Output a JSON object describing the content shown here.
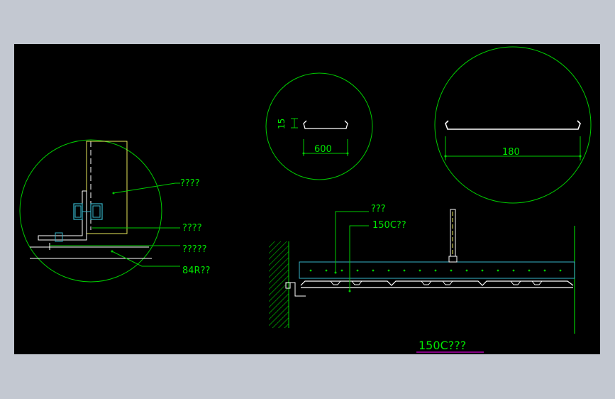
{
  "colors": {
    "background": "#c3c8d1",
    "canvas": "#000000",
    "circle": "#00cc00",
    "text": "#00e600",
    "leader": "#00cc00",
    "profile": "#ffffff",
    "bracket": "#e8e85a",
    "bolt": "#36b3c8",
    "title_underline": "#d400d4"
  },
  "detail_left": {
    "labels": [
      "????",
      "????",
      "?????",
      "84R??"
    ]
  },
  "detail_small": {
    "height_label": "15",
    "width_label": "600"
  },
  "detail_large": {
    "width_label": "180"
  },
  "section": {
    "label_top": "???",
    "label_second": "150C??",
    "title": "150C???"
  }
}
